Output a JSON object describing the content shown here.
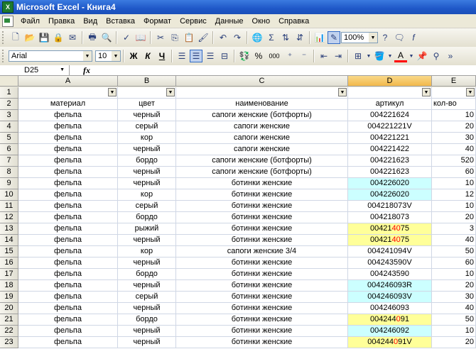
{
  "window": {
    "title": "Microsoft Excel - Книга4",
    "app_icon": "excel-icon"
  },
  "menu": [
    "Файл",
    "Правка",
    "Вид",
    "Вставка",
    "Формат",
    "Сервис",
    "Данные",
    "Окно",
    "Справка"
  ],
  "toolbar": {
    "zoom": "100%",
    "font_name": "Arial",
    "font_size": "10",
    "bold": "Ж",
    "italic": "К",
    "underline": "Ч",
    "percent": "%",
    "thousands": "000",
    "sigma": "Σ"
  },
  "formula_bar": {
    "name_box": "D25",
    "fx_label": "fx",
    "formula": ""
  },
  "columns": [
    "A",
    "B",
    "C",
    "D",
    "E"
  ],
  "headers": [
    "материал",
    "цвет",
    "наименование",
    "артикул",
    "кол-во"
  ],
  "rows": [
    {
      "n": "3",
      "cells": [
        "фельпа",
        "черный",
        "сапоги женские (ботфорты)",
        "004221624",
        "10"
      ],
      "hl": ""
    },
    {
      "n": "4",
      "cells": [
        "фельпа",
        "серый",
        "сапоги женские",
        "004221221V",
        "20"
      ],
      "hl": ""
    },
    {
      "n": "5",
      "cells": [
        "фельпа",
        "кор",
        "сапоги женские",
        "004221221",
        "30"
      ],
      "hl": ""
    },
    {
      "n": "6",
      "cells": [
        "фельпа",
        "черный",
        "сапоги женские",
        "004221422",
        "40"
      ],
      "hl": ""
    },
    {
      "n": "7",
      "cells": [
        "фельпа",
        "бордо",
        "сапоги женские (ботфорты)",
        "004221623",
        "520"
      ],
      "hl": ""
    },
    {
      "n": "8",
      "cells": [
        "фельпа",
        "черный",
        "сапоги женские (ботфорты)",
        "004221623",
        "60"
      ],
      "hl": ""
    },
    {
      "n": "9",
      "cells": [
        "фельпа",
        "черный",
        "ботинки женские",
        "004226020",
        "10"
      ],
      "hl": "cyan"
    },
    {
      "n": "10",
      "cells": [
        "фельпа",
        "кор",
        "ботинки женские",
        "004226020",
        "12"
      ],
      "hl": "cyan"
    },
    {
      "n": "11",
      "cells": [
        "фельпа",
        "серый",
        "ботинки женские",
        "004218073V",
        "10"
      ],
      "hl": ""
    },
    {
      "n": "12",
      "cells": [
        "фельпа",
        "бордо",
        "ботинки женские",
        "004218073",
        "20"
      ],
      "hl": ""
    },
    {
      "n": "13",
      "cells": [
        "фельпа",
        "рыжий",
        "ботинки женские",
        "004214075",
        "3"
      ],
      "hl": "yellow",
      "red": [
        5,
        7
      ]
    },
    {
      "n": "14",
      "cells": [
        "фельпа",
        "черный",
        "ботинки женские",
        "004214075",
        "40"
      ],
      "hl": "yellow",
      "red": [
        5,
        7
      ]
    },
    {
      "n": "15",
      "cells": [
        "фельпа",
        "кор",
        "сапоги женские 3/4",
        "004241094V",
        "50"
      ],
      "hl": ""
    },
    {
      "n": "16",
      "cells": [
        "фельпа",
        "черный",
        "ботинки женские",
        "004243590V",
        "60"
      ],
      "hl": ""
    },
    {
      "n": "17",
      "cells": [
        "фельпа",
        "бордо",
        "ботинки женские",
        "004243590",
        "10"
      ],
      "hl": ""
    },
    {
      "n": "18",
      "cells": [
        "фельпа",
        "черный",
        "ботинки женские",
        "004246093R",
        "20"
      ],
      "hl": "cyan"
    },
    {
      "n": "19",
      "cells": [
        "фельпа",
        "серый",
        "ботинки женские",
        "004246093V",
        "30"
      ],
      "hl": "cyan"
    },
    {
      "n": "20",
      "cells": [
        "фельпа",
        "черный",
        "ботинки женские",
        "004246093",
        "40"
      ],
      "hl": ""
    },
    {
      "n": "21",
      "cells": [
        "фельпа",
        "бордо",
        "ботинки женские",
        "004244091",
        "50"
      ],
      "hl": "yellow",
      "red": [
        6,
        7
      ]
    },
    {
      "n": "22",
      "cells": [
        "фельпа",
        "черный",
        "ботинки женские",
        "004246092",
        "10"
      ],
      "hl": "cyan"
    },
    {
      "n": "23",
      "cells": [
        "фельпа",
        "черный",
        "ботинки женские",
        "004244091V",
        "20"
      ],
      "hl": "yellow",
      "red": [
        6,
        7
      ]
    }
  ]
}
